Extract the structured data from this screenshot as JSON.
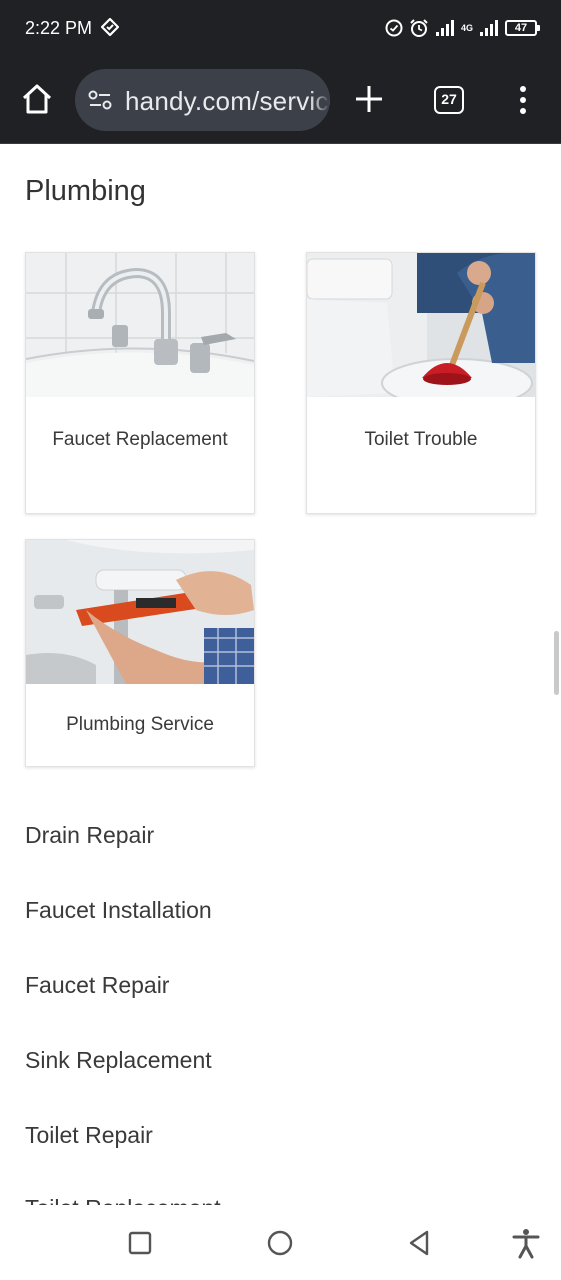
{
  "status_bar": {
    "time": "2:22 PM",
    "battery": "47",
    "network": "4G"
  },
  "browser": {
    "url": "handy.com/services/plumbing",
    "tab_count": "27"
  },
  "page": {
    "section_title": "Plumbing",
    "cards": [
      {
        "label": "Faucet Replacement",
        "image": "faucet-photo"
      },
      {
        "label": "Toilet Trouble",
        "image": "plunger-toilet-photo"
      },
      {
        "label": "Plumbing Service",
        "image": "pipe-wrench-photo"
      }
    ],
    "links": [
      "Drain Repair",
      "Faucet Installation",
      "Faucet Repair",
      "Sink Replacement",
      "Toilet Repair",
      "Toilet Replacement"
    ]
  },
  "colors": {
    "chrome_bg": "#202124",
    "omnibox_bg": "#3c4048",
    "text": "#3a3a3a"
  }
}
